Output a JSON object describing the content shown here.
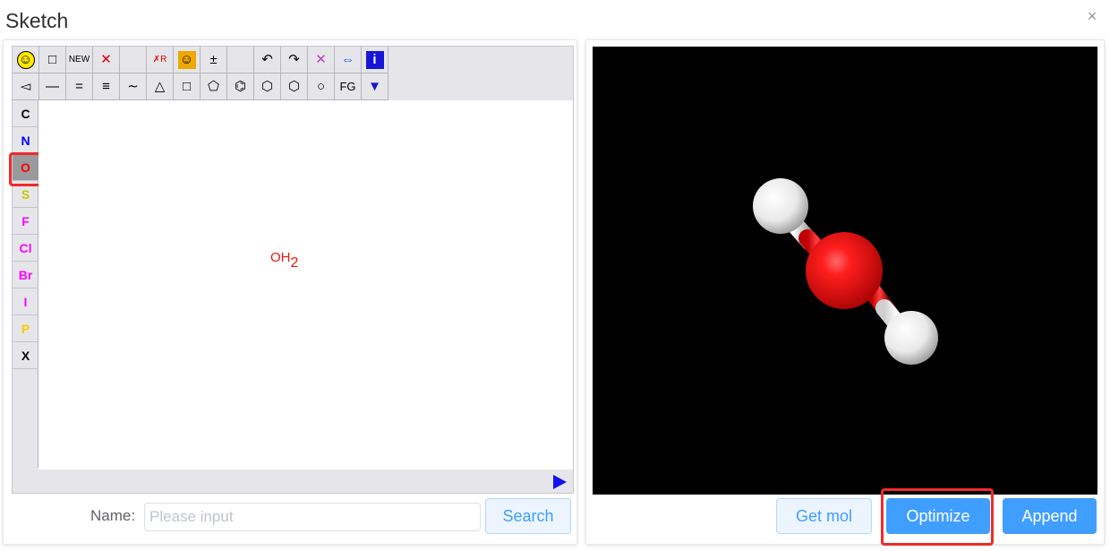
{
  "dialog": {
    "title": "Sketch",
    "close_glyph": "×"
  },
  "toolbar": {
    "row1": [
      {
        "name": "smiley-icon",
        "glyph": "☺",
        "interactable": true,
        "color": "#000000",
        "bg": "#ffe800"
      },
      {
        "name": "select-rectangle-icon",
        "glyph": "□",
        "interactable": true,
        "color": "#000000"
      },
      {
        "name": "new-button",
        "glyph": "NEW",
        "interactable": true,
        "color": "#000000",
        "small": true
      },
      {
        "name": "delete-icon",
        "glyph": "✕",
        "interactable": true,
        "color": "#e00000"
      },
      {
        "name": "toolbar-empty-1",
        "glyph": "",
        "interactable": false
      },
      {
        "name": "delete-r-group-icon",
        "glyph": "✗R",
        "interactable": true,
        "color": "#e00000",
        "small": true
      },
      {
        "name": "smiley-active-icon",
        "glyph": "☺",
        "interactable": true,
        "color": "#000000",
        "bg": "#f0a800"
      },
      {
        "name": "charge-icon",
        "glyph": "±",
        "interactable": true,
        "color": "#000000"
      },
      {
        "name": "toolbar-empty-2",
        "glyph": "",
        "interactable": false
      },
      {
        "name": "undo-icon",
        "glyph": "↶",
        "interactable": true,
        "color": "#000000"
      },
      {
        "name": "redo-icon",
        "glyph": "↷",
        "interactable": true,
        "color": "#000000"
      },
      {
        "name": "clear-icon",
        "glyph": "✕",
        "interactable": true,
        "color": "#c040c0"
      },
      {
        "name": "move-icon",
        "glyph": "⇔",
        "interactable": true,
        "color": "#1060d0"
      },
      {
        "name": "info-icon",
        "glyph": "i",
        "interactable": true,
        "color": "#ffffff",
        "bg": "#1616d8"
      }
    ],
    "row2": [
      {
        "name": "wedge-bond-icon",
        "glyph": "◅",
        "interactable": true,
        "color": "#000000"
      },
      {
        "name": "single-bond-icon",
        "glyph": "—",
        "interactable": true,
        "color": "#000000"
      },
      {
        "name": "double-bond-icon",
        "glyph": "=",
        "interactable": true,
        "color": "#000000"
      },
      {
        "name": "triple-bond-icon",
        "glyph": "≡",
        "interactable": true,
        "color": "#000000"
      },
      {
        "name": "chain-icon",
        "glyph": "∼",
        "interactable": true,
        "color": "#000000"
      },
      {
        "name": "ring-3-icon",
        "glyph": "△",
        "interactable": true,
        "color": "#000000"
      },
      {
        "name": "ring-4-icon",
        "glyph": "□",
        "interactable": true,
        "color": "#000000"
      },
      {
        "name": "ring-5-icon",
        "glyph": "⬠",
        "interactable": true,
        "color": "#000000"
      },
      {
        "name": "benzene-icon",
        "glyph": "⌬",
        "interactable": true,
        "color": "#000000"
      },
      {
        "name": "ring-6-icon",
        "glyph": "⬡",
        "interactable": true,
        "color": "#000000"
      },
      {
        "name": "ring-7-icon",
        "glyph": "⬡",
        "interactable": true,
        "color": "#000000"
      },
      {
        "name": "ring-8-icon",
        "glyph": "○",
        "interactable": true,
        "color": "#000000"
      },
      {
        "name": "fg-button",
        "glyph": "FG",
        "interactable": true,
        "color": "#000000"
      },
      {
        "name": "triangles-icon",
        "glyph": "▼",
        "interactable": true,
        "color": "#1616d8"
      }
    ]
  },
  "atoms": [
    {
      "label": "C",
      "color": "#000000",
      "selected": false
    },
    {
      "label": "N",
      "color": "#0000ff",
      "selected": false
    },
    {
      "label": "O",
      "color": "#ff0000",
      "selected": true
    },
    {
      "label": "S",
      "color": "#c8c800",
      "selected": false
    },
    {
      "label": "F",
      "color": "#ff00ff",
      "selected": false
    },
    {
      "label": "Cl",
      "color": "#ff00ff",
      "selected": false
    },
    {
      "label": "Br",
      "color": "#ff00ff",
      "selected": false
    },
    {
      "label": "I",
      "color": "#ff00ff",
      "selected": false
    },
    {
      "label": "P",
      "color": "#ffc800",
      "selected": false
    },
    {
      "label": "X",
      "color": "#000000",
      "selected": false
    }
  ],
  "canvas": {
    "molecule_text": "OH",
    "molecule_subscript": "2"
  },
  "search": {
    "label": "Name:",
    "placeholder": "Please input",
    "value": "",
    "button": "Search"
  },
  "viewer": {
    "background": "#000000",
    "oxygen_color": "#ff0000",
    "hydrogen_color": "#ffffff"
  },
  "actions": {
    "get_mol": "Get mol",
    "optimize": "Optimize",
    "append": "Append"
  }
}
